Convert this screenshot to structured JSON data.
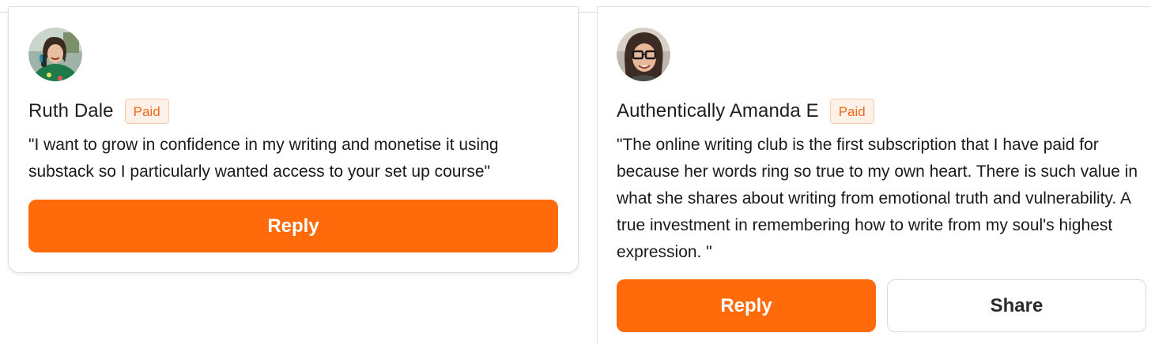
{
  "comments": [
    {
      "author": "Ruth Dale",
      "badge": "Paid",
      "text": "\"I want to grow in confidence in my writing and monetise it using substack so I particularly wanted access to your set up course\"",
      "reply_label": "Reply"
    },
    {
      "author": "Authentically Amanda E",
      "badge": "Paid",
      "text": "\"The online writing club is the first subscription that I have paid for because her words ring so true to my own heart. There is such value in what she shares about writing from emotional truth and vulnerability. A true investment in remembering how to write from my soul's highest expression. \"",
      "reply_label": "Reply",
      "share_label": "Share"
    }
  ],
  "colors": {
    "accent": "#ff6b0a",
    "badge_text": "#f06a1a",
    "badge_bg": "#fff1e8"
  }
}
